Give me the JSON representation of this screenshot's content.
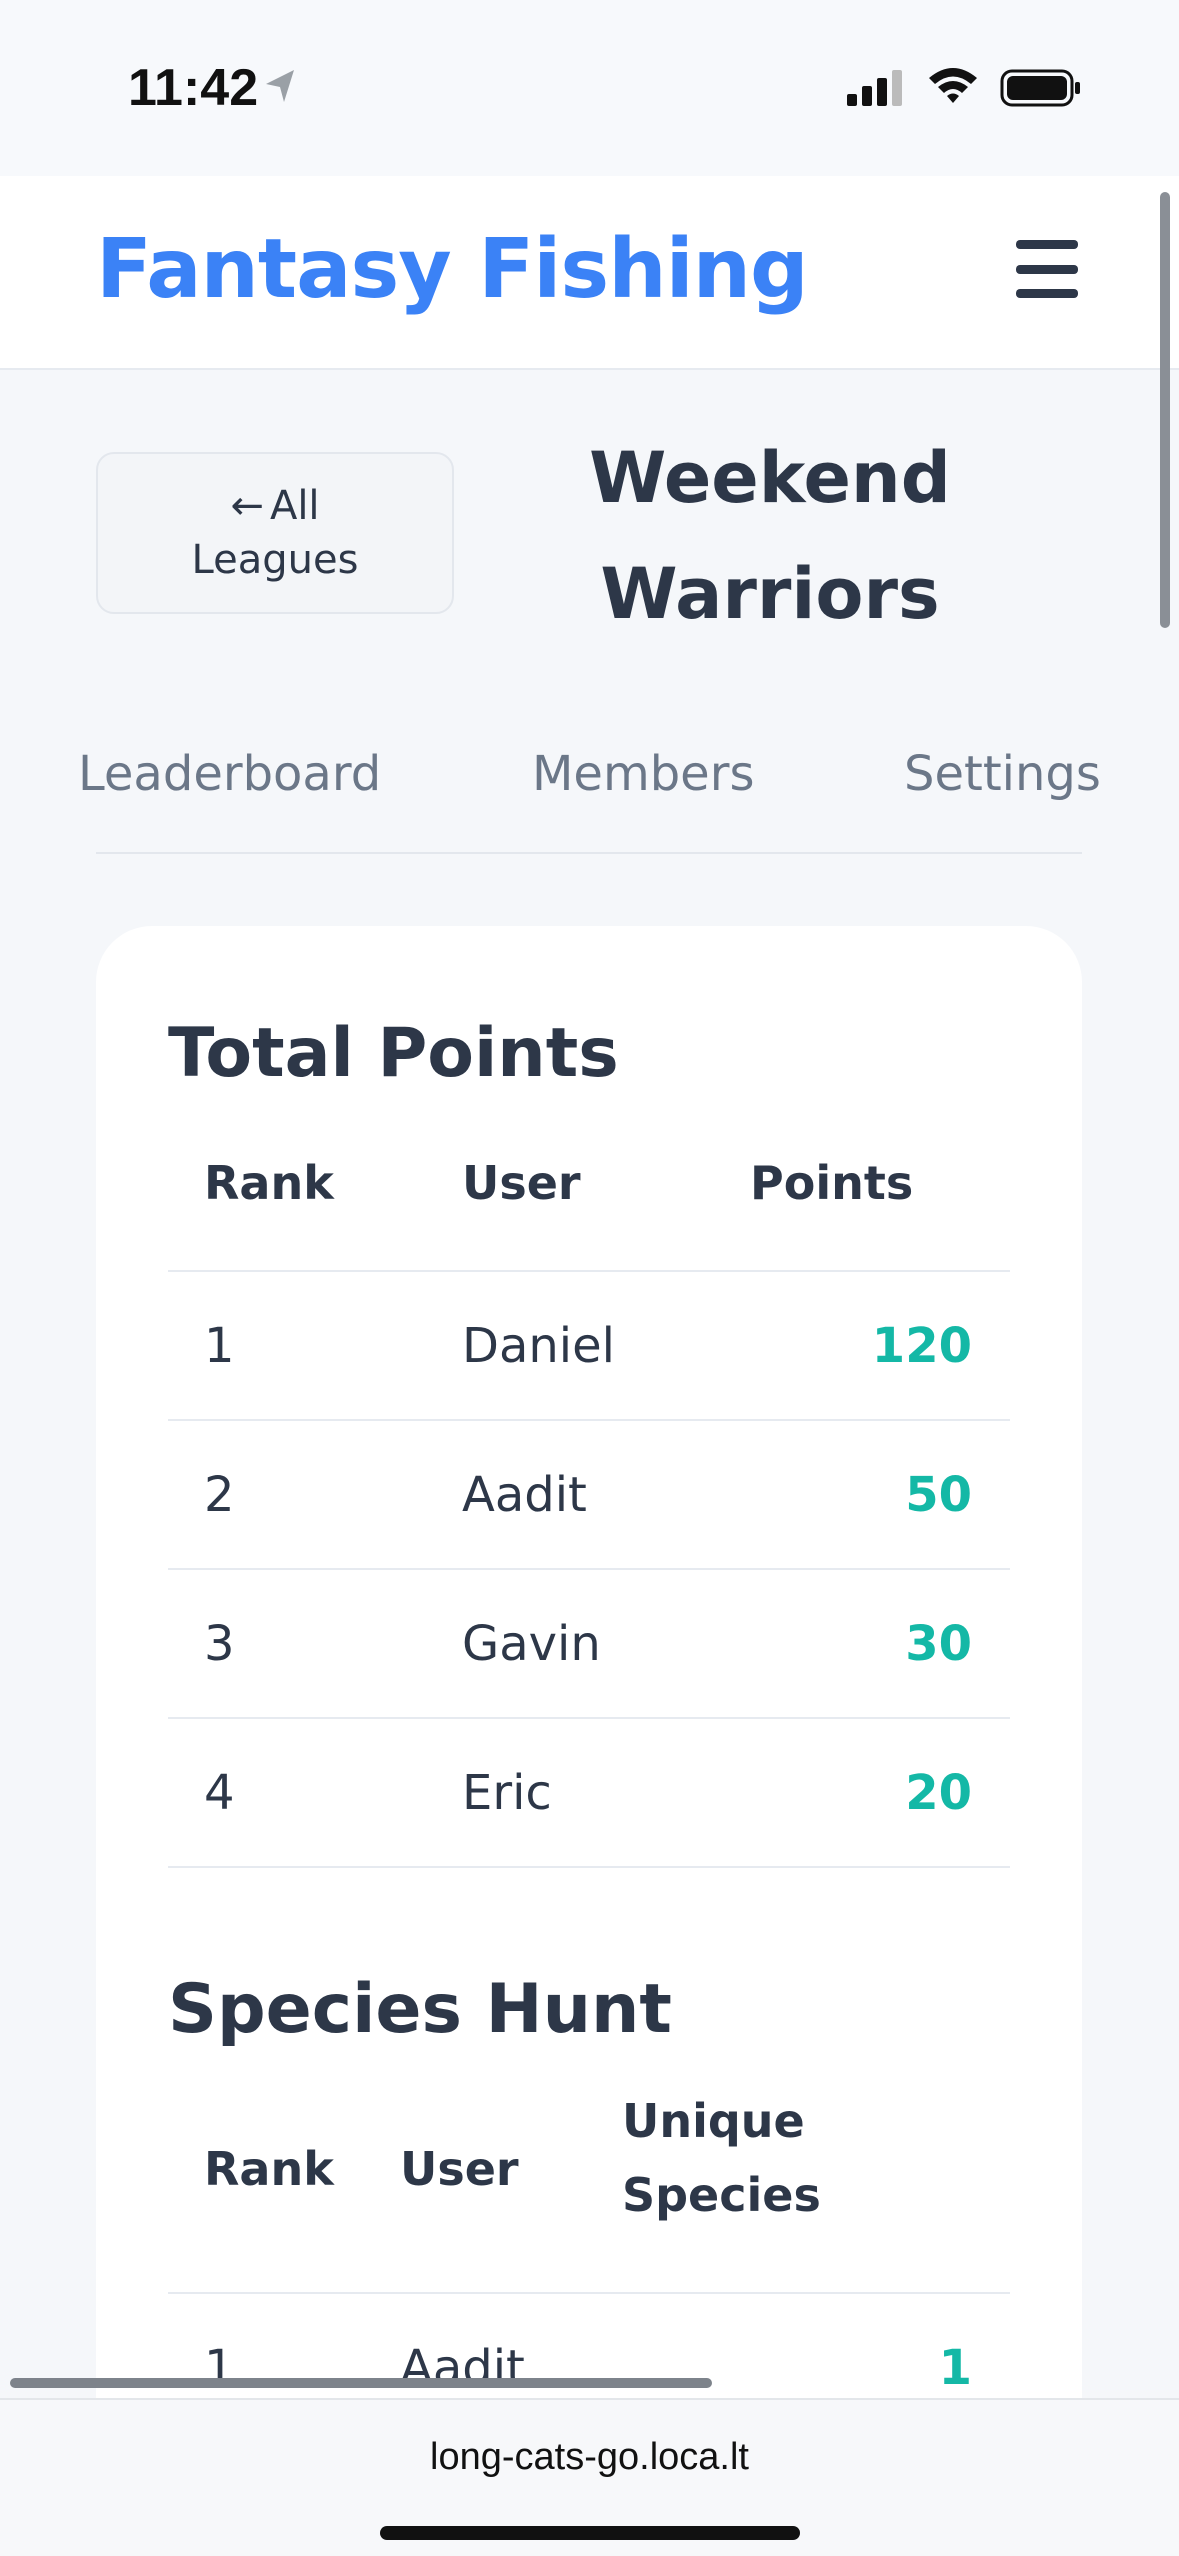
{
  "status_bar": {
    "time": "11:42"
  },
  "header": {
    "brand": "Fantasy Fishing"
  },
  "league": {
    "back_arrow": "←",
    "back_line1": "All",
    "back_line2": "Leagues",
    "title_line1": "Weekend",
    "title_line2": "Warriors"
  },
  "tabs": [
    "Leaderboard",
    "Members",
    "Settings"
  ],
  "total_points": {
    "title": "Total Points",
    "headers": [
      "Rank",
      "User",
      "Points"
    ],
    "rows": [
      {
        "rank": "1",
        "user": "Daniel",
        "points": "120"
      },
      {
        "rank": "2",
        "user": "Aadit",
        "points": "50"
      },
      {
        "rank": "3",
        "user": "Gavin",
        "points": "30"
      },
      {
        "rank": "4",
        "user": "Eric",
        "points": "20"
      }
    ]
  },
  "species_hunt": {
    "title": "Species Hunt",
    "headers": [
      "Rank",
      "User",
      "Unique",
      "Species"
    ],
    "rows": [
      {
        "rank": "1",
        "user": "Aadit",
        "count": "1"
      }
    ]
  },
  "browser": {
    "url": "long-cats-go.loca.lt"
  },
  "colors": {
    "brand": "#3b82f6",
    "points": "#14b8a6",
    "text": "#2d3748"
  },
  "icons": [
    "location-arrow-icon",
    "signal-icon",
    "wifi-icon",
    "battery-icon",
    "hamburger-menu-icon",
    "back-arrow-icon"
  ]
}
